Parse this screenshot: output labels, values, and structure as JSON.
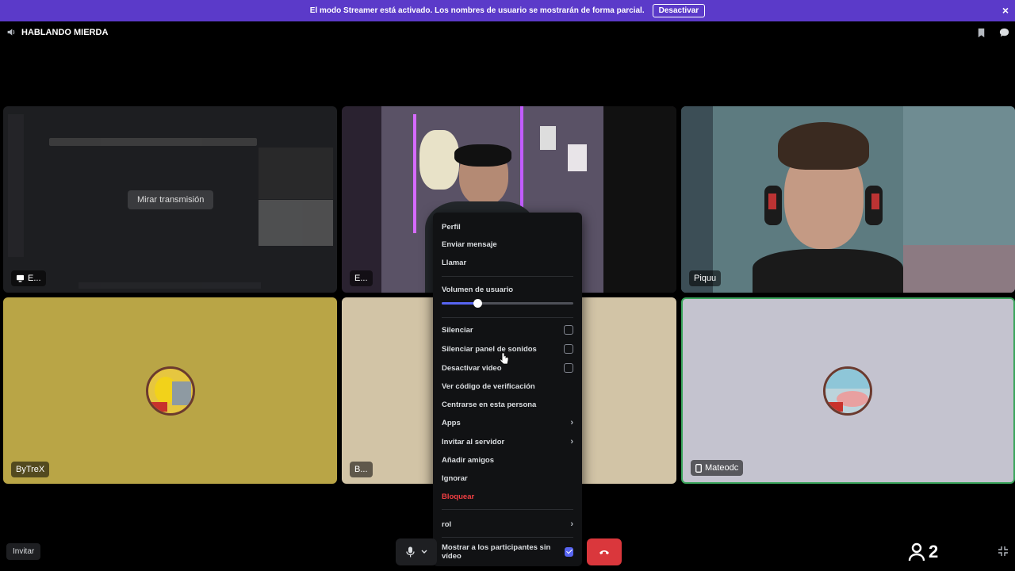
{
  "banner": {
    "text": "El modo Streamer está activado. Los nombres de usuario se mostrarán de forma parcial.",
    "button": "Desactivar",
    "close": "×"
  },
  "channel": {
    "name": "HABLANDO MIERDA"
  },
  "tiles": {
    "t1": {
      "label": "E...",
      "button": "Mirar transmisión"
    },
    "t2": {
      "label": "E..."
    },
    "t3": {
      "label": "Piquu"
    },
    "t4": {
      "label": "ByTreX"
    },
    "t5": {
      "label": "B..."
    },
    "t6": {
      "label": "Mateodc"
    }
  },
  "menu": {
    "profile": "Perfil",
    "message": "Enviar mensaje",
    "call": "Llamar",
    "volume_label": "Volumen de usuario",
    "volume_fraction": 0.27,
    "mute": "Silenciar",
    "mute_soundboard": "Silenciar panel de sonidos",
    "disable_video": "Desactivar video",
    "verify_code": "Ver código de verificación",
    "focus": "Centrarse en esta persona",
    "apps": "Apps",
    "invite_server": "Invitar al servidor",
    "add_friends": "Añadir amigos",
    "ignore": "Ignorar",
    "block": "Bloquear",
    "role": "rol",
    "show_no_video": "Mostrar a los participantes sin vídeo"
  },
  "footer": {
    "invite": "Invitar",
    "participants": "2"
  },
  "colors": {
    "banner": "#5b3ac9",
    "tile_yellow": "#b9a546",
    "tile_beige": "#d2c4a6",
    "tile_grey": "#c4c3cf",
    "accent": "#5865f2",
    "danger": "#da373c",
    "speaking": "#3ba55c"
  }
}
